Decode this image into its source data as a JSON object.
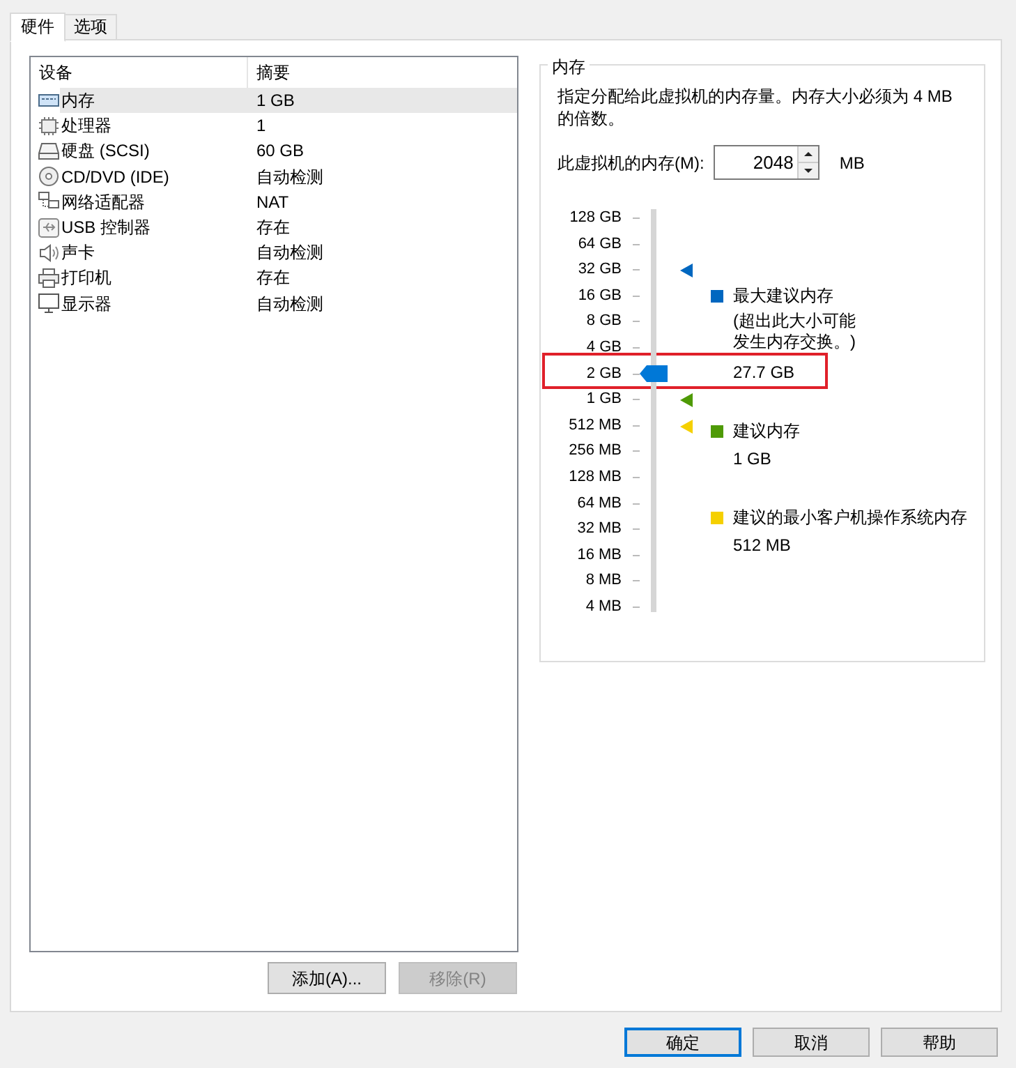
{
  "tabs": [
    {
      "label": "硬件",
      "selected": true
    },
    {
      "label": "选项",
      "selected": false
    }
  ],
  "devices": {
    "columns": [
      "设备",
      "摘要"
    ],
    "rows": [
      {
        "kind": "memory",
        "name": "内存",
        "summary": "1 GB",
        "selected": true
      },
      {
        "kind": "cpu",
        "name": "处理器",
        "summary": "1",
        "selected": false
      },
      {
        "kind": "disk",
        "name": "硬盘 (SCSI)",
        "summary": "60 GB",
        "selected": false
      },
      {
        "kind": "cd",
        "name": "CD/DVD (IDE)",
        "summary": "自动检测",
        "selected": false
      },
      {
        "kind": "network",
        "name": "网络适配器",
        "summary": "NAT",
        "selected": false
      },
      {
        "kind": "usb",
        "name": "USB 控制器",
        "summary": "存在",
        "selected": false
      },
      {
        "kind": "sound",
        "name": "声卡",
        "summary": "自动检测",
        "selected": false
      },
      {
        "kind": "printer",
        "name": "打印机",
        "summary": "存在",
        "selected": false
      },
      {
        "kind": "display",
        "name": "显示器",
        "summary": "自动检测",
        "selected": false
      }
    ],
    "buttons": [
      {
        "label": "添加(A)...",
        "disabled": false
      },
      {
        "label": "移除(R)",
        "disabled": true
      }
    ]
  },
  "memory": {
    "title": "内存",
    "description": "指定分配给此虚拟机的内存量。内存大小必须为 4 MB 的倍数。",
    "field_label": "此虚拟机的内存(M):",
    "value": "2048",
    "unit": "MB",
    "slider": {
      "level": 0.6
    },
    "ticks": [
      {
        "label": "128 GB"
      },
      {
        "label": "64 GB"
      },
      {
        "label": "32 GB",
        "color": "#0067c0"
      },
      {
        "label": "16 GB"
      },
      {
        "label": "8 GB"
      },
      {
        "label": "4 GB"
      },
      {
        "label": "2 GB",
        "highlighted": true
      },
      {
        "label": "1 GB",
        "color": "#4e9a06"
      },
      {
        "label": "512 MB",
        "color": "#f5d000"
      },
      {
        "label": "256 MB"
      },
      {
        "label": "128 MB"
      },
      {
        "label": "64 MB"
      },
      {
        "label": "32 MB"
      },
      {
        "label": "16 MB"
      },
      {
        "label": "8 MB"
      },
      {
        "label": "4 MB"
      }
    ],
    "legend": [
      {
        "color": "#0067c0",
        "title": "最大建议内存",
        "note": "(超出此大小可能发生内存交换。)",
        "value": "27.7 GB"
      },
      {
        "color": "#4e9a06",
        "title": "建议内存",
        "value": "1 GB"
      },
      {
        "color": "#f5d000",
        "title": "建议的最小客户机操作系统内存",
        "value": "512 MB"
      }
    ]
  },
  "dialog_buttons": [
    {
      "label": "确定",
      "default": true
    },
    {
      "label": "取消",
      "default": false
    },
    {
      "label": "帮助",
      "default": false
    }
  ]
}
